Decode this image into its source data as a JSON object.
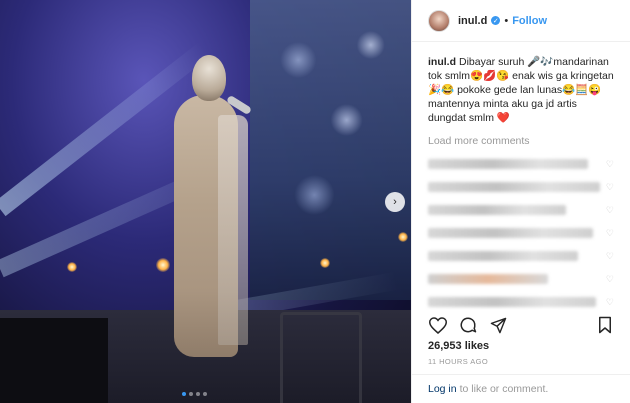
{
  "post": {
    "username": "inul.d",
    "separator": "•",
    "follow_label": "Follow",
    "caption_user": "inul.d",
    "caption_text": "Dibayar suruh 🎤🎶mandarinan tok smlm😍💋😘 enak wis ga kringetan 🎉😂 pokoke gede lan lunas😂🧮😜 mantennya minta aku ga jd artis dungdat smlm ❤️",
    "load_more": "Load more comments",
    "likes": "26,953 likes",
    "timestamp": "11 HOURS AGO",
    "login_link": "Log in",
    "login_suffix": "to like or comment.",
    "carousel_next": "›"
  },
  "colors": {
    "link_blue": "#3897f0",
    "text": "#262626",
    "muted": "#999999",
    "heart_red": "#ed4956"
  },
  "icons": {
    "like": "heart-outline-icon",
    "comment": "comment-bubble-icon",
    "share": "paper-plane-icon",
    "save": "bookmark-icon",
    "verified": "verified-badge-icon"
  }
}
